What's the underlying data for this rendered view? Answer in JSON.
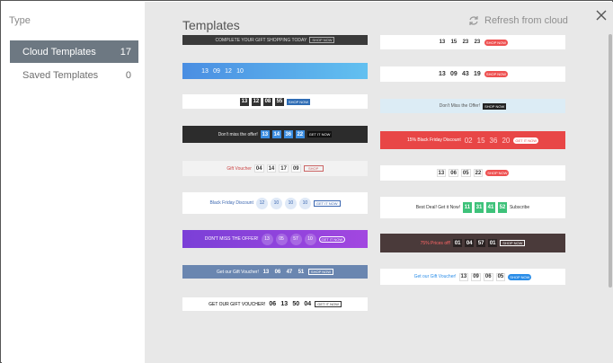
{
  "sidebar": {
    "heading": "Type",
    "items": [
      {
        "label": "Cloud Templates",
        "count": "17"
      },
      {
        "label": "Saved Templates",
        "count": "0"
      }
    ]
  },
  "main": {
    "title": "Templates",
    "refresh_label": "Refresh from cloud"
  },
  "templates": {
    "t1": {
      "text": "COMPLETE YOUR GIFT SHOPPING TODAY",
      "button": "SHOP NOW"
    },
    "t2": {
      "digits": [
        "13",
        "09",
        "12",
        "10"
      ]
    },
    "t3": {
      "digits": [
        "13",
        "12",
        "08",
        "55"
      ],
      "button": "SHOP NOW"
    },
    "t4": {
      "text": "Don't miss the offer!",
      "digits": [
        "13",
        "14",
        "36",
        "22"
      ],
      "button": "GET IT NOW"
    },
    "t5": {
      "text": "Gift Voucher",
      "digits": [
        "04",
        "14",
        "17",
        "09"
      ],
      "button": "SHOP"
    },
    "t6": {
      "text": "Black Friday Discount",
      "digits": [
        "12",
        "10",
        "10",
        "10"
      ],
      "button": "GET IT NOW"
    },
    "t7": {
      "text": "DON'T MISS THE OFFER!",
      "digits": [
        "13",
        "05",
        "57",
        "10"
      ],
      "button": "GET IT NOW"
    },
    "t8": {
      "text": "Get our Gift Voucher!",
      "digits": [
        "13",
        "06",
        "47",
        "51"
      ],
      "button": "SHOP NOW"
    },
    "t9": {
      "text": "GET OUR GIFT VOUCHER!",
      "digits": [
        "06",
        "13",
        "50",
        "04"
      ],
      "button": "GET IT NOW"
    },
    "u1": {
      "digits": [
        "13",
        "15",
        "23",
        "23"
      ],
      "button": "SHOP NOW"
    },
    "u2": {
      "digits": [
        "13",
        "09",
        "43",
        "19"
      ],
      "button": "SHOP NOW"
    },
    "u3": {
      "text": "Don't Miss the Offer!",
      "button": "SHOP NOW"
    },
    "u4": {
      "text": "15% Black Friday Discount",
      "digits": [
        "02",
        "15",
        "36",
        "20"
      ],
      "button": "GET IT NOW"
    },
    "u5": {
      "digits": [
        "13",
        "06",
        "05",
        "22"
      ],
      "button": "SHOP NOW"
    },
    "u6": {
      "text": "Best Deal! Get it Now!",
      "digits": [
        "11",
        "31",
        "41",
        "52"
      ],
      "button": "Subscribe"
    },
    "u7": {
      "text": "75% Prices off!",
      "digits": [
        "01",
        "04",
        "57",
        "01"
      ],
      "button": "SHOP NOW"
    },
    "u8": {
      "text": "Get our Gift Voucher!",
      "digits": [
        "13",
        "09",
        "06",
        "05"
      ],
      "button": "SHOP NOW"
    }
  },
  "colors": {
    "sidebar_active": "#6d7882",
    "main_bg": "#e8e8e8"
  }
}
